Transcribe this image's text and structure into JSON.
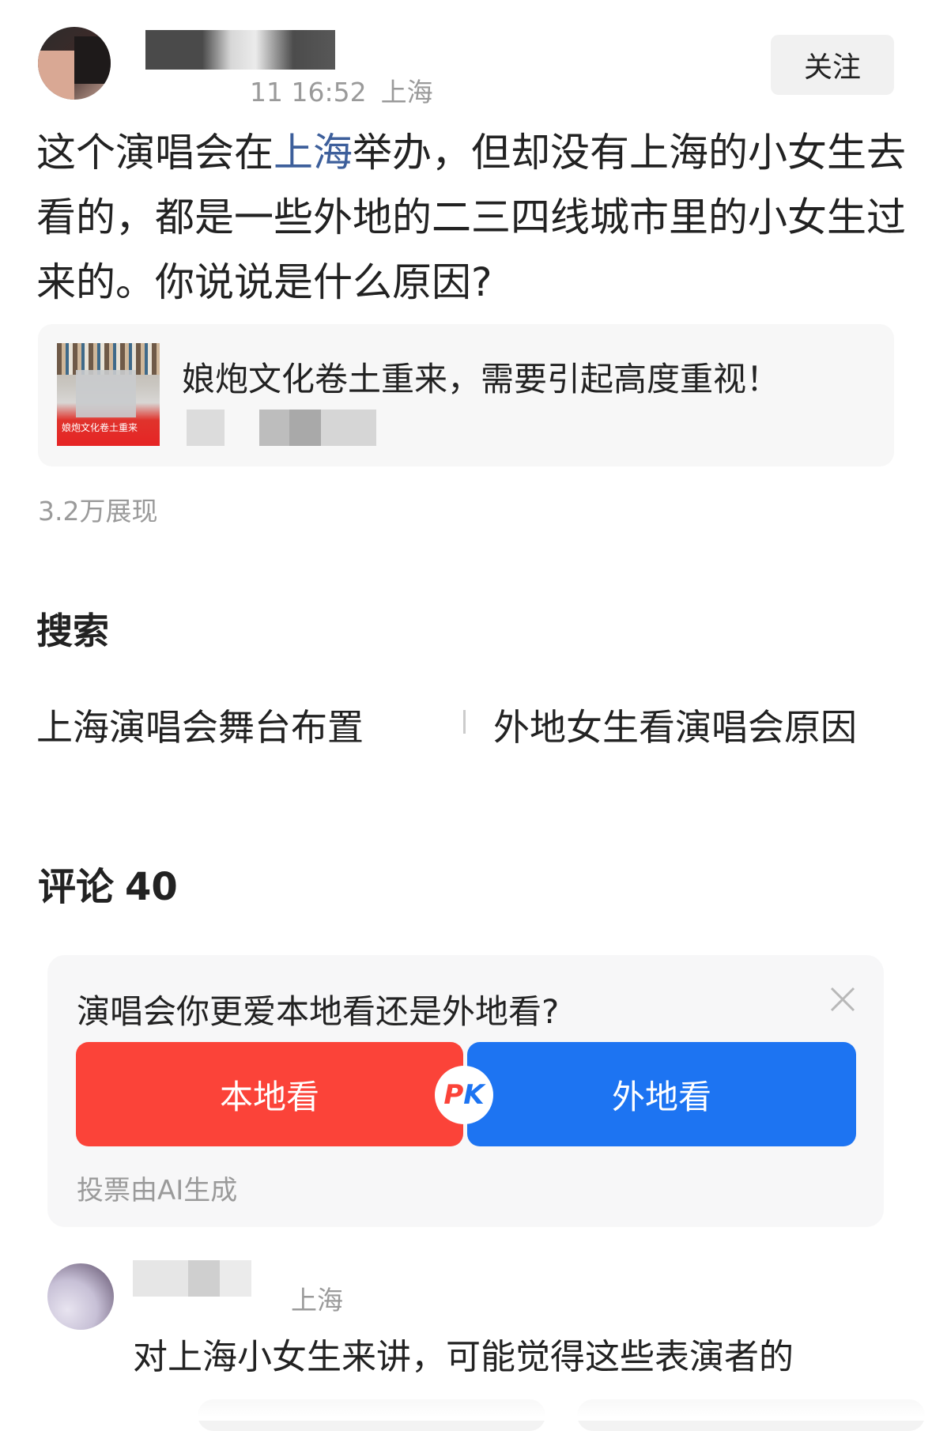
{
  "post": {
    "time": "11 16:52",
    "location": "上海",
    "follow_label": "关注",
    "body_before_link": "这个演唱会在",
    "body_link": "上海",
    "body_after_link": "举办，但却没有上海的小女生去看的，都是一些外地的二三四线城市里的小女生过来的。你说说是什么原因?",
    "views": "3.2万展现"
  },
  "quote_card": {
    "title": "娘炮文化卷土重来，需要引起高度重视！",
    "thumb_text": "娘炮文化卷土重来"
  },
  "search": {
    "heading": "搜索",
    "links": [
      "上海演唱会舞台布置",
      "外地女生看演唱会原因"
    ]
  },
  "comments": {
    "heading": "评论",
    "count": "40"
  },
  "vote": {
    "question": "演唱会你更爱本地看还是外地看?",
    "option_local": "本地看",
    "option_remote": "外地看",
    "pk_p": "P",
    "pk_k": "K",
    "note": "投票由AI生成",
    "colors": {
      "local": "#fb4339",
      "remote": "#1d74f2"
    }
  },
  "comment": {
    "location_fragment": "上海",
    "text": "对上海小女生来讲，可能觉得这些表演者的"
  },
  "icons": {
    "vote_close": "close-icon",
    "link_color": "#3d5f9b"
  }
}
